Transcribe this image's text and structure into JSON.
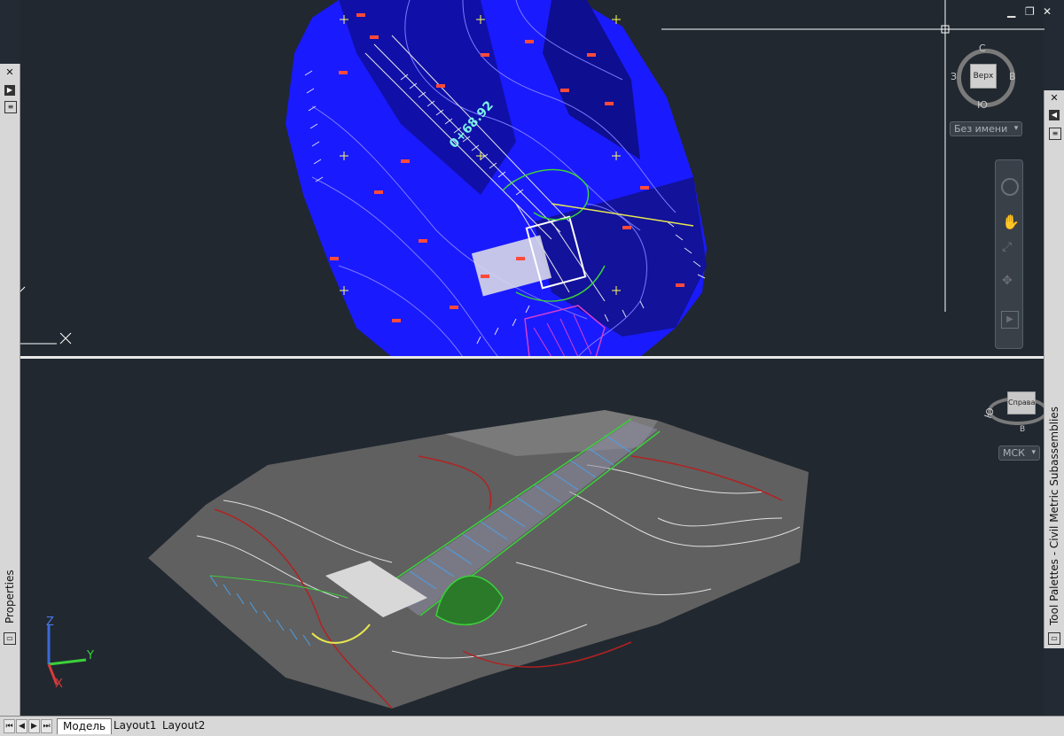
{
  "viewcube_top": {
    "face": "Верх",
    "north": "С",
    "south": "Ю",
    "east": "В",
    "west": "З",
    "ucs_menu": "Без имени"
  },
  "viewcube_bottom": {
    "face": "Справа",
    "north": "Ю",
    "east": "В",
    "ucs_menu": "МСК"
  },
  "drawing": {
    "station_label": "0+68.92"
  },
  "ucs_axes": {
    "x": "X",
    "y": "Y",
    "z": "Z"
  },
  "palettes": {
    "left_title": "Properties",
    "right_title": "Tool Palettes - Civil Metric Subassemblies"
  },
  "tabs": [
    {
      "label": "Модель",
      "active": true
    },
    {
      "label": "Layout1",
      "active": false
    },
    {
      "label": "Layout2",
      "active": false
    }
  ],
  "colors": {
    "surface_blue": "#1a1aff",
    "contour_red": "#ff4a3a",
    "mesh_gray": "#606060",
    "alignment_green": "#3ad13a",
    "viewport_bg": "#212830"
  }
}
